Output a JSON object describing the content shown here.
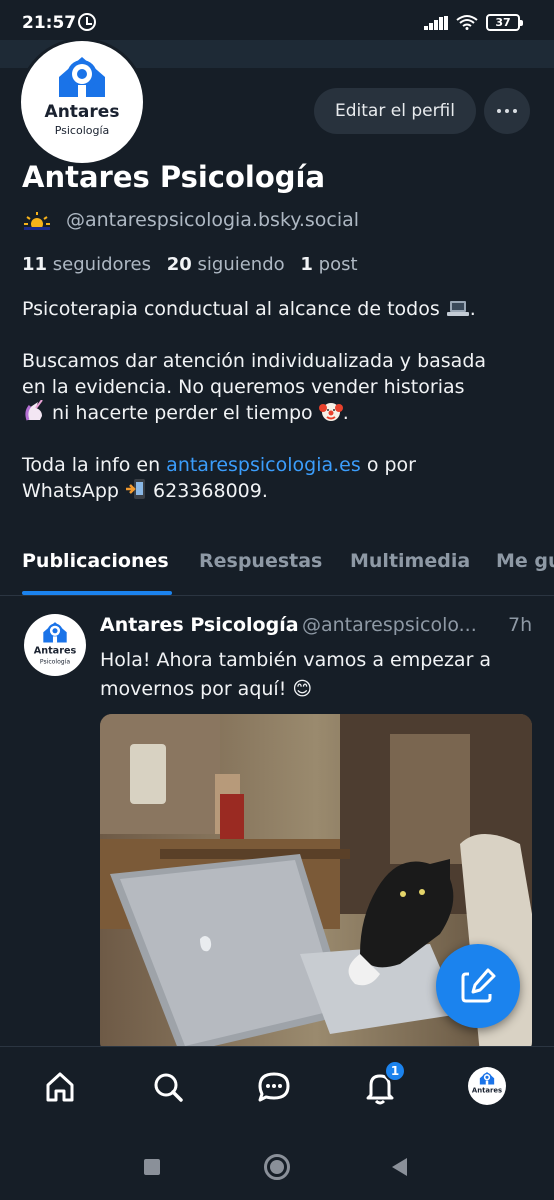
{
  "status_bar": {
    "time": "21:57",
    "battery": "37"
  },
  "profile": {
    "logo_text": "Antares",
    "logo_subtext": "Psicología",
    "edit_label": "Editar el perfil",
    "display_name": "Antares Psicología",
    "verified_emoji": "sun-behind-small-cloud",
    "handle": "@antarespsicologia.bsky.social",
    "followers_count": "11",
    "followers_label": "seguidores",
    "following_count": "20",
    "following_label": "siguiendo",
    "posts_count": "1",
    "posts_label": "post",
    "bio": {
      "line1": "Psicoterapia conductual al alcance de todos",
      "line2a": "Buscamos dar atención individualizada y basada",
      "line2b": "en la evidencia. No queremos vender historias",
      "line2c": "ni hacerte perder el tiempo",
      "line3a": "Toda la info en",
      "link": "antarespsicologia.es",
      "line3b": "o por",
      "line3c": "WhatsApp",
      "phone": "623368009."
    }
  },
  "tabs": [
    {
      "label": "Publicaciones",
      "active": true
    },
    {
      "label": "Respuestas",
      "active": false
    },
    {
      "label": "Multimedia",
      "active": false
    },
    {
      "label": "Me gu",
      "active": false
    }
  ],
  "post": {
    "author": "Antares Psicología",
    "handle": "@antarespsicolo...",
    "time": "7h",
    "text": "Hola! Ahora también vamos a empezar a movernos por aquí! 😊",
    "media": "cat-typing-on-laptop-gif"
  },
  "nav": {
    "badge_count": "1",
    "items": [
      "home-icon",
      "search-icon",
      "chat-icon",
      "bell-icon",
      "profile-avatar"
    ]
  },
  "colors": {
    "background": "#161e27",
    "accent": "#1b83ee",
    "muted_text": "#8e99a5"
  }
}
